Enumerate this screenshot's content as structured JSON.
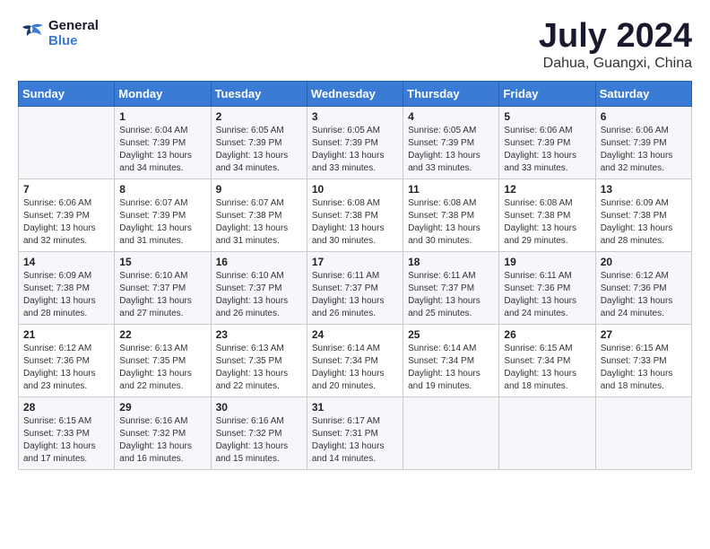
{
  "header": {
    "logo_line1": "General",
    "logo_line2": "Blue",
    "month": "July 2024",
    "location": "Dahua, Guangxi, China"
  },
  "days_of_week": [
    "Sunday",
    "Monday",
    "Tuesday",
    "Wednesday",
    "Thursday",
    "Friday",
    "Saturday"
  ],
  "weeks": [
    [
      {
        "day": "",
        "info": ""
      },
      {
        "day": "1",
        "info": "Sunrise: 6:04 AM\nSunset: 7:39 PM\nDaylight: 13 hours\nand 34 minutes."
      },
      {
        "day": "2",
        "info": "Sunrise: 6:05 AM\nSunset: 7:39 PM\nDaylight: 13 hours\nand 34 minutes."
      },
      {
        "day": "3",
        "info": "Sunrise: 6:05 AM\nSunset: 7:39 PM\nDaylight: 13 hours\nand 33 minutes."
      },
      {
        "day": "4",
        "info": "Sunrise: 6:05 AM\nSunset: 7:39 PM\nDaylight: 13 hours\nand 33 minutes."
      },
      {
        "day": "5",
        "info": "Sunrise: 6:06 AM\nSunset: 7:39 PM\nDaylight: 13 hours\nand 33 minutes."
      },
      {
        "day": "6",
        "info": "Sunrise: 6:06 AM\nSunset: 7:39 PM\nDaylight: 13 hours\nand 32 minutes."
      }
    ],
    [
      {
        "day": "7",
        "info": "Sunrise: 6:06 AM\nSunset: 7:39 PM\nDaylight: 13 hours\nand 32 minutes."
      },
      {
        "day": "8",
        "info": "Sunrise: 6:07 AM\nSunset: 7:39 PM\nDaylight: 13 hours\nand 31 minutes."
      },
      {
        "day": "9",
        "info": "Sunrise: 6:07 AM\nSunset: 7:38 PM\nDaylight: 13 hours\nand 31 minutes."
      },
      {
        "day": "10",
        "info": "Sunrise: 6:08 AM\nSunset: 7:38 PM\nDaylight: 13 hours\nand 30 minutes."
      },
      {
        "day": "11",
        "info": "Sunrise: 6:08 AM\nSunset: 7:38 PM\nDaylight: 13 hours\nand 30 minutes."
      },
      {
        "day": "12",
        "info": "Sunrise: 6:08 AM\nSunset: 7:38 PM\nDaylight: 13 hours\nand 29 minutes."
      },
      {
        "day": "13",
        "info": "Sunrise: 6:09 AM\nSunset: 7:38 PM\nDaylight: 13 hours\nand 28 minutes."
      }
    ],
    [
      {
        "day": "14",
        "info": "Sunrise: 6:09 AM\nSunset: 7:38 PM\nDaylight: 13 hours\nand 28 minutes."
      },
      {
        "day": "15",
        "info": "Sunrise: 6:10 AM\nSunset: 7:37 PM\nDaylight: 13 hours\nand 27 minutes."
      },
      {
        "day": "16",
        "info": "Sunrise: 6:10 AM\nSunset: 7:37 PM\nDaylight: 13 hours\nand 26 minutes."
      },
      {
        "day": "17",
        "info": "Sunrise: 6:11 AM\nSunset: 7:37 PM\nDaylight: 13 hours\nand 26 minutes."
      },
      {
        "day": "18",
        "info": "Sunrise: 6:11 AM\nSunset: 7:37 PM\nDaylight: 13 hours\nand 25 minutes."
      },
      {
        "day": "19",
        "info": "Sunrise: 6:11 AM\nSunset: 7:36 PM\nDaylight: 13 hours\nand 24 minutes."
      },
      {
        "day": "20",
        "info": "Sunrise: 6:12 AM\nSunset: 7:36 PM\nDaylight: 13 hours\nand 24 minutes."
      }
    ],
    [
      {
        "day": "21",
        "info": "Sunrise: 6:12 AM\nSunset: 7:36 PM\nDaylight: 13 hours\nand 23 minutes."
      },
      {
        "day": "22",
        "info": "Sunrise: 6:13 AM\nSunset: 7:35 PM\nDaylight: 13 hours\nand 22 minutes."
      },
      {
        "day": "23",
        "info": "Sunrise: 6:13 AM\nSunset: 7:35 PM\nDaylight: 13 hours\nand 22 minutes."
      },
      {
        "day": "24",
        "info": "Sunrise: 6:14 AM\nSunset: 7:34 PM\nDaylight: 13 hours\nand 20 minutes."
      },
      {
        "day": "25",
        "info": "Sunrise: 6:14 AM\nSunset: 7:34 PM\nDaylight: 13 hours\nand 19 minutes."
      },
      {
        "day": "26",
        "info": "Sunrise: 6:15 AM\nSunset: 7:34 PM\nDaylight: 13 hours\nand 18 minutes."
      },
      {
        "day": "27",
        "info": "Sunrise: 6:15 AM\nSunset: 7:33 PM\nDaylight: 13 hours\nand 18 minutes."
      }
    ],
    [
      {
        "day": "28",
        "info": "Sunrise: 6:15 AM\nSunset: 7:33 PM\nDaylight: 13 hours\nand 17 minutes."
      },
      {
        "day": "29",
        "info": "Sunrise: 6:16 AM\nSunset: 7:32 PM\nDaylight: 13 hours\nand 16 minutes."
      },
      {
        "day": "30",
        "info": "Sunrise: 6:16 AM\nSunset: 7:32 PM\nDaylight: 13 hours\nand 15 minutes."
      },
      {
        "day": "31",
        "info": "Sunrise: 6:17 AM\nSunset: 7:31 PM\nDaylight: 13 hours\nand 14 minutes."
      },
      {
        "day": "",
        "info": ""
      },
      {
        "day": "",
        "info": ""
      },
      {
        "day": "",
        "info": ""
      }
    ]
  ]
}
